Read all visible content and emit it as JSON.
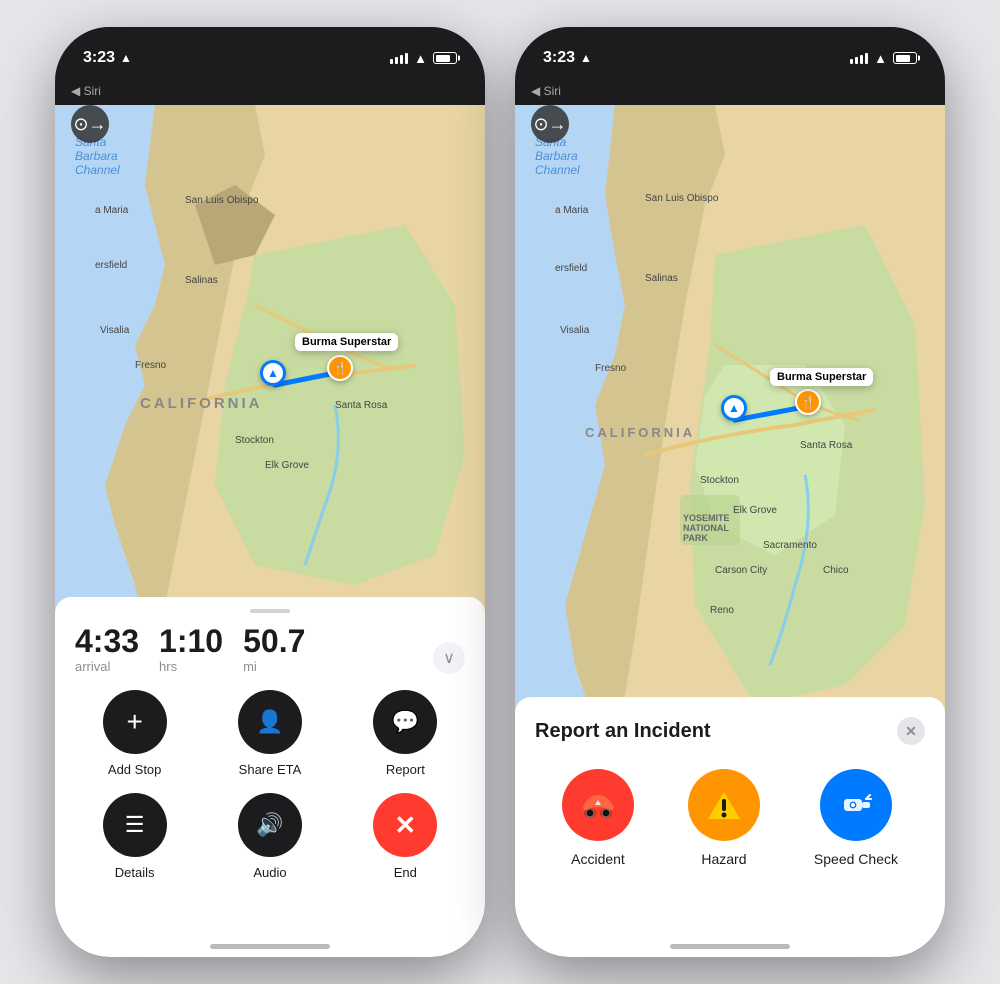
{
  "phone1": {
    "status": {
      "time": "3:23",
      "location_arrow": "▲",
      "siri": "◀ Siri"
    },
    "back_icon": "↩",
    "map": {
      "destination": "Burma Superstar",
      "region_label": "CALIFORNIA",
      "cities": [
        "San Luis Obispo",
        "Salinas",
        "Fresno",
        "Visalia",
        "Stockton",
        "Santa Rosa",
        "Elk Grove"
      ]
    },
    "nav": {
      "arrival": "4:33",
      "arrival_label": "arrival",
      "duration": "1:10",
      "duration_label": "hrs",
      "distance": "50.7",
      "distance_label": "mi",
      "expand": "∨"
    },
    "actions": [
      {
        "id": "add-stop",
        "icon": "+",
        "label": "Add Stop",
        "style": "dark"
      },
      {
        "id": "share-eta",
        "icon": "👤+",
        "label": "Share ETA",
        "style": "dark"
      },
      {
        "id": "report",
        "icon": "💬",
        "label": "Report",
        "style": "dark"
      },
      {
        "id": "details",
        "icon": "≡",
        "label": "Details",
        "style": "dark"
      },
      {
        "id": "audio",
        "icon": "🔊",
        "label": "Audio",
        "style": "dark"
      },
      {
        "id": "end",
        "icon": "✕",
        "label": "End",
        "style": "red"
      }
    ]
  },
  "phone2": {
    "status": {
      "time": "3:23",
      "location_arrow": "▲",
      "siri": "◀ Siri"
    },
    "back_icon": "↩",
    "map": {
      "destination": "Burma Superstar",
      "region_label": "CALIFORNIA"
    },
    "incident": {
      "title": "Report an Incident",
      "close": "✕",
      "options": [
        {
          "id": "accident",
          "label": "Accident",
          "icon": "🚗💥",
          "style": "red"
        },
        {
          "id": "hazard",
          "label": "Hazard",
          "icon": "⚠️",
          "style": "yellow"
        },
        {
          "id": "speed-check",
          "label": "Speed Check",
          "icon": "📡",
          "style": "blue"
        }
      ]
    }
  }
}
